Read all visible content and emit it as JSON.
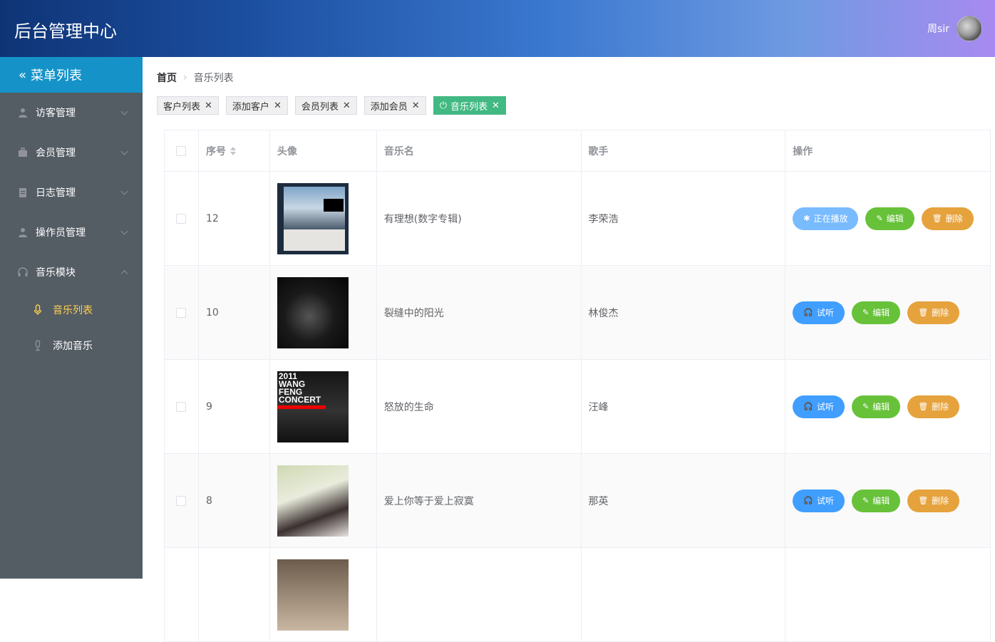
{
  "app": {
    "title": "后台管理中心",
    "user": "周sir"
  },
  "sidebar": {
    "header": "菜单列表",
    "items": [
      {
        "label": "访客管理",
        "icon": "user-icon"
      },
      {
        "label": "会员管理",
        "icon": "briefcase-icon"
      },
      {
        "label": "日志管理",
        "icon": "document-icon"
      },
      {
        "label": "操作员管理",
        "icon": "user-icon"
      },
      {
        "label": "音乐模块",
        "icon": "headset-icon",
        "expanded": true
      }
    ],
    "sub_items": [
      {
        "label": "音乐列表",
        "icon": "microphone-icon",
        "active": true
      },
      {
        "label": "添加音乐",
        "icon": "microphone-icon"
      }
    ],
    "active_color": "#ffd04b"
  },
  "breadcrumb": {
    "home": "首页",
    "current": "音乐列表"
  },
  "tags": [
    {
      "label": "客户列表"
    },
    {
      "label": "添加客户"
    },
    {
      "label": "会员列表"
    },
    {
      "label": "添加会员"
    },
    {
      "label": "音乐列表",
      "active": true
    }
  ],
  "table": {
    "headers": [
      "序号",
      "头像",
      "音乐名",
      "歌手",
      "操作"
    ],
    "rows": [
      {
        "id": "12",
        "name": "有理想(数字专辑)",
        "singer": "李荣浩",
        "play": "正在播放",
        "edit": "编辑",
        "del": "删除"
      },
      {
        "id": "10",
        "name": "裂缝中的阳光",
        "singer": "林俊杰",
        "play": "试听",
        "edit": "编辑",
        "del": "删除"
      },
      {
        "id": "9",
        "name": "怒放的生命",
        "singer": "汪峰",
        "play": "试听",
        "edit": "编辑",
        "del": "删除"
      },
      {
        "id": "8",
        "name": "爱上你等于爱上寂寞",
        "singer": "那英",
        "play": "试听",
        "edit": "编辑",
        "del": "删除"
      }
    ],
    "cover3_text": "2011\nWANG\nFENG\nCONCERT"
  },
  "colors": {
    "primary": "#409eff",
    "success": "#67c23a",
    "warning": "#e6a23c",
    "tag_active": "#42b983",
    "sidebar": "#545c64"
  }
}
